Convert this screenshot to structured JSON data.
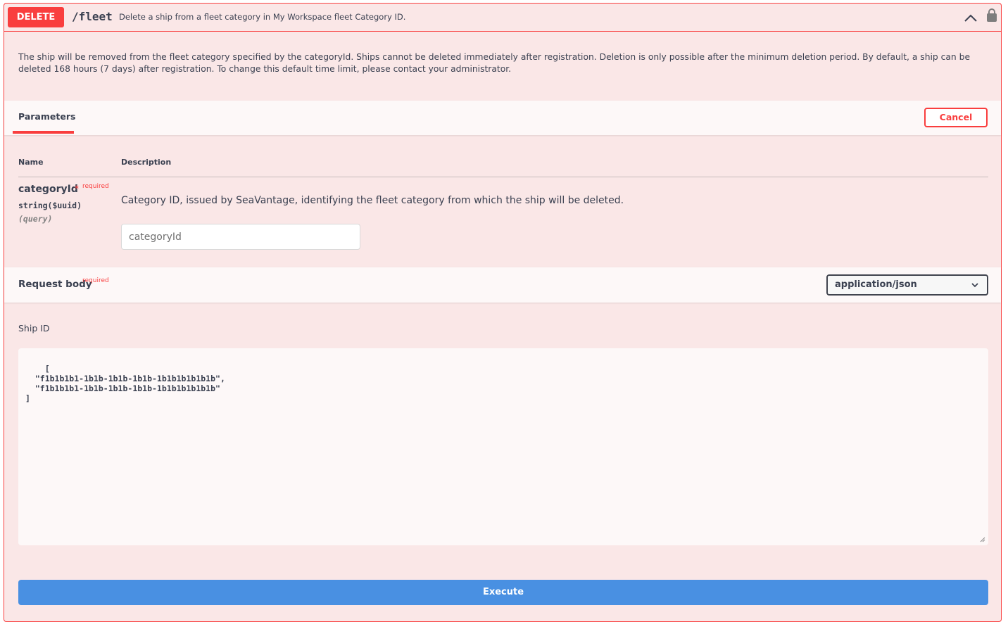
{
  "operation": {
    "method": "DELETE",
    "path": "/fleet",
    "summary": "Delete a ship from a fleet category in My Workspace fleet Category ID.",
    "description": "The ship will be removed from the fleet category specified by the categoryId. Ships cannot be deleted immediately after registration. Deletion is only possible after the minimum deletion period. By default, a ship can be deleted 168 hours (7 days) after registration. To change this default time limit, please contact your administrator."
  },
  "parameters": {
    "tab_label": "Parameters",
    "cancel_label": "Cancel",
    "col_name": "Name",
    "col_description": "Description",
    "items": [
      {
        "name": "categoryId",
        "required_star": "*",
        "required_label": "required",
        "type": "string($uuid)",
        "in": "(query)",
        "description": "Category ID, issued by SeaVantage, identifying the fleet category from which the ship will be deleted.",
        "placeholder": "categoryId"
      }
    ]
  },
  "request_body": {
    "title": "Request body",
    "required_label": "required",
    "content_type": "application/json",
    "field_label": "Ship ID",
    "value": "[\n  \"f1b1b1b1-1b1b-1b1b-1b1b-1b1b1b1b1b1b\",\n  \"f1b1b1b1-1b1b-1b1b-1b1b-1b1b1b1b1b1b\"\n]"
  },
  "execute_label": "Execute",
  "colors": {
    "delete": "#f93e3e",
    "execute": "#4990e2",
    "block_bg": "#fae7e7"
  }
}
